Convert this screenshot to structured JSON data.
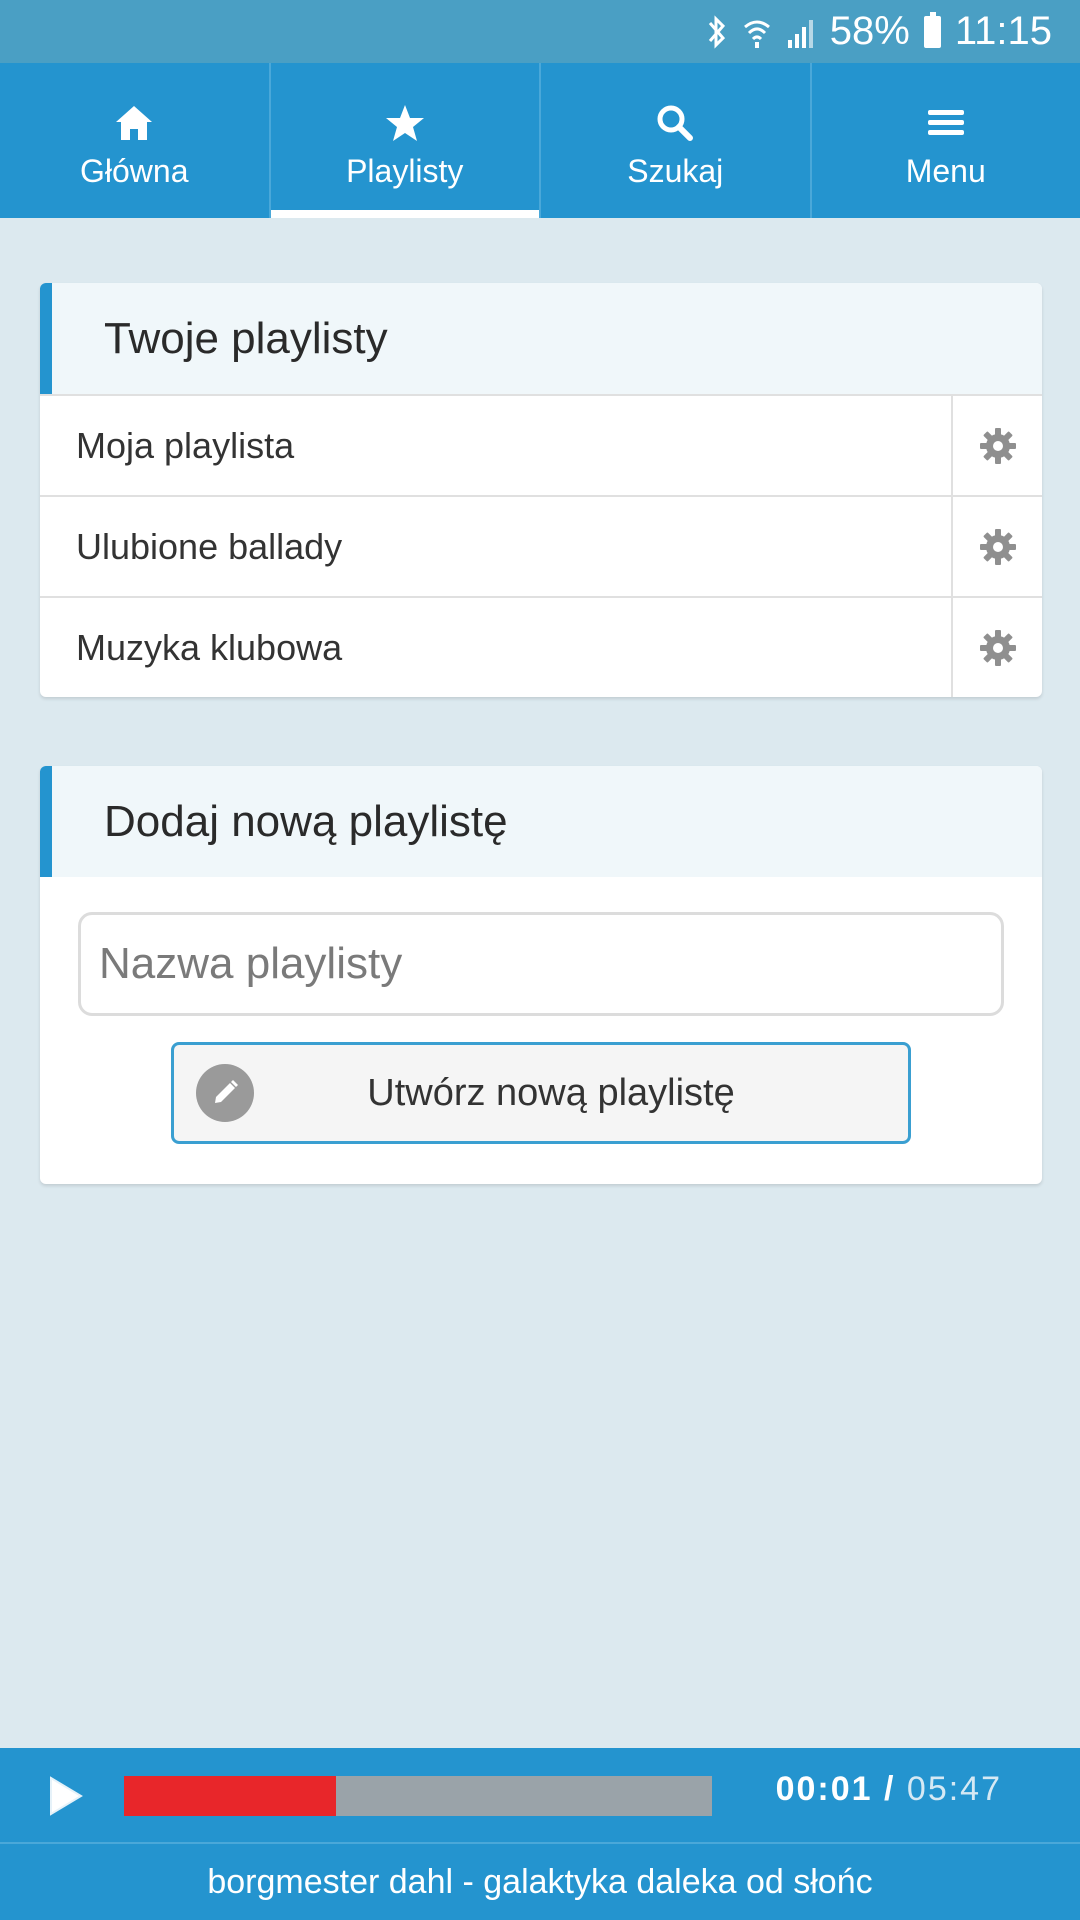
{
  "status_bar": {
    "battery": "58%",
    "time": "11:15",
    "icons": [
      "bluetooth-icon",
      "wifi-icon",
      "signal-icon",
      "battery-icon"
    ]
  },
  "nav": {
    "tabs": [
      {
        "label": "Główna",
        "icon": "home-icon",
        "active": false
      },
      {
        "label": "Playlisty",
        "icon": "star-icon",
        "active": true
      },
      {
        "label": "Szukaj",
        "icon": "search-icon",
        "active": false
      },
      {
        "label": "Menu",
        "icon": "hamburger-icon",
        "active": false
      }
    ]
  },
  "playlists_panel": {
    "title": "Twoje playlisty",
    "items": [
      {
        "name": "Moja playlista"
      },
      {
        "name": "Ulubione ballady"
      },
      {
        "name": "Muzyka klubowa"
      }
    ]
  },
  "new_playlist_panel": {
    "title": "Dodaj nową playlistę",
    "input_placeholder": "Nazwa playlisty",
    "input_value": "",
    "create_button_label": "Utwórz nową playlistę"
  },
  "player": {
    "current_time": "00:01",
    "separator": "/",
    "total_time": "05:47",
    "progress_fraction": 0.36,
    "track_title": "borgmester dahl - galaktyka daleka od słońc"
  },
  "colors": {
    "accent": "#2494cf",
    "status_bar": "#4a9fc4",
    "background": "#dce9ef",
    "progress_fill": "#e8262a"
  }
}
